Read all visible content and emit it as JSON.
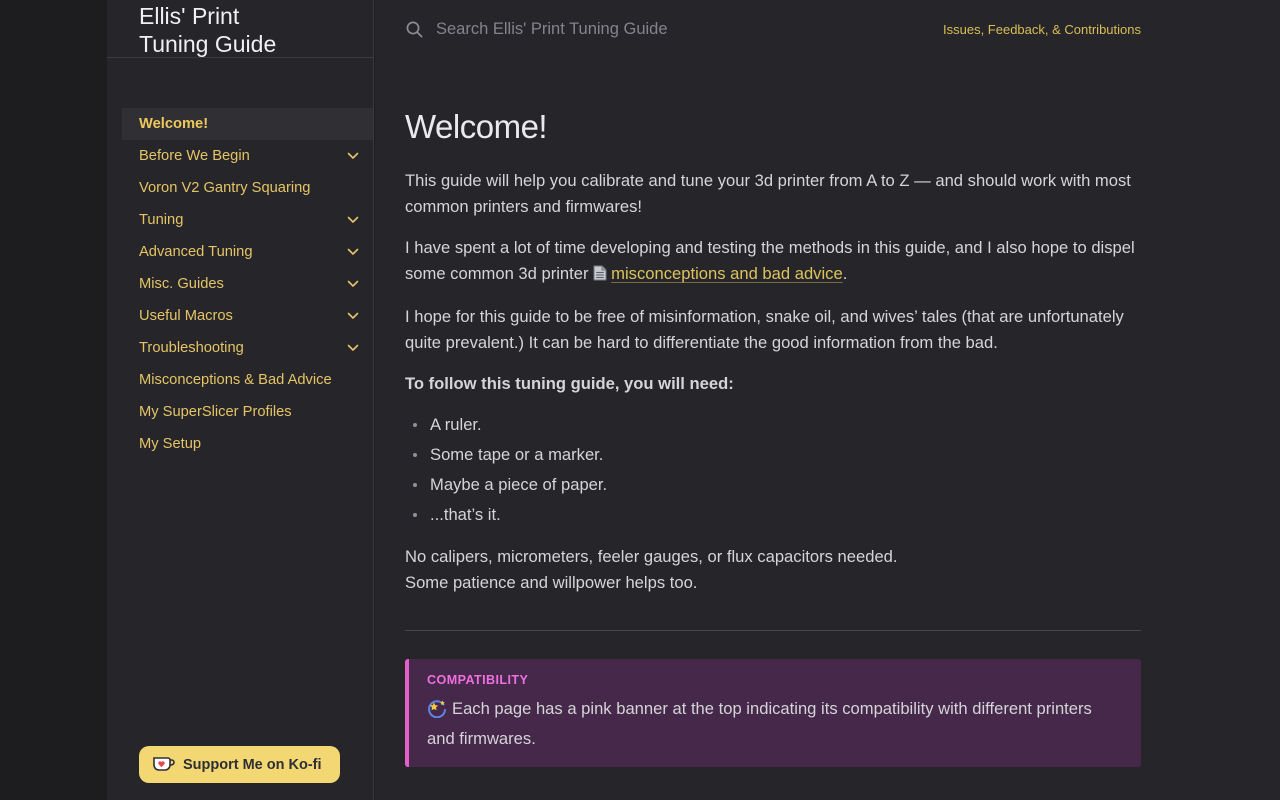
{
  "header": {
    "site_title_line1": "Ellis' Print",
    "site_title_line2": "Tuning Guide",
    "search_placeholder": "Search Ellis' Print Tuning Guide",
    "repo_link": "Issues, Feedback, & Contributions"
  },
  "sidebar": {
    "items": [
      {
        "label": "Welcome!",
        "active": true,
        "expandable": false
      },
      {
        "label": "Before We Begin",
        "active": false,
        "expandable": true
      },
      {
        "label": "Voron V2 Gantry Squaring",
        "active": false,
        "expandable": false
      },
      {
        "label": "Tuning",
        "active": false,
        "expandable": true
      },
      {
        "label": "Advanced Tuning",
        "active": false,
        "expandable": true
      },
      {
        "label": "Misc. Guides",
        "active": false,
        "expandable": true
      },
      {
        "label": "Useful Macros",
        "active": false,
        "expandable": true
      },
      {
        "label": "Troubleshooting",
        "active": false,
        "expandable": true
      },
      {
        "label": "Misconceptions & Bad Advice",
        "active": false,
        "expandable": false
      },
      {
        "label": "My SuperSlicer Profiles",
        "active": false,
        "expandable": false
      },
      {
        "label": "My Setup",
        "active": false,
        "expandable": false
      }
    ],
    "kofi_label": "Support Me on Ko-fi"
  },
  "main": {
    "title": "Welcome!",
    "p1": "This guide will help you calibrate and tune your 3d printer from A to Z — and should work with most common printers and firmwares!",
    "p2_before_link": "I have spent a lot of time developing and testing the methods in this guide, and I also hope to dispel some common 3d printer ",
    "p2_link": "misconceptions and bad advice",
    "p2_after_link": ".",
    "p3": "I hope for this guide to be free of misinformation, snake oil, and wives’ tales (that are unfortunately quite prevalent.) It can be hard to differentiate the good information from the bad.",
    "needs_heading": "To follow this tuning guide, you will need:",
    "list": [
      "A ruler.",
      "Some tape or a marker.",
      "Maybe a piece of paper.",
      "...that’s it."
    ],
    "outro_line1": "No calipers, micrometers, feeler gauges, or flux capacitors needed.",
    "outro_line2": "Some patience and willpower helps too.",
    "admonition": {
      "label": "COMPATIBILITY",
      "text": "Each page has a pink banner at the top indicating its compatibility with different printers and firmwares."
    }
  },
  "icons": {
    "search": "magnifying-glass",
    "chevron": "chevron-down",
    "page": "page-facing-up",
    "dizzy": "dizzy-star",
    "kofi": "coffee-cup-heart"
  },
  "colors": {
    "accent_yellow": "#e4c466",
    "link_gold": "#d9bd55",
    "kofi_yellow": "#f2d772",
    "banner_bg": "#45284a",
    "banner_border": "#e65fc8",
    "banner_label_pink": "#f06fde"
  }
}
